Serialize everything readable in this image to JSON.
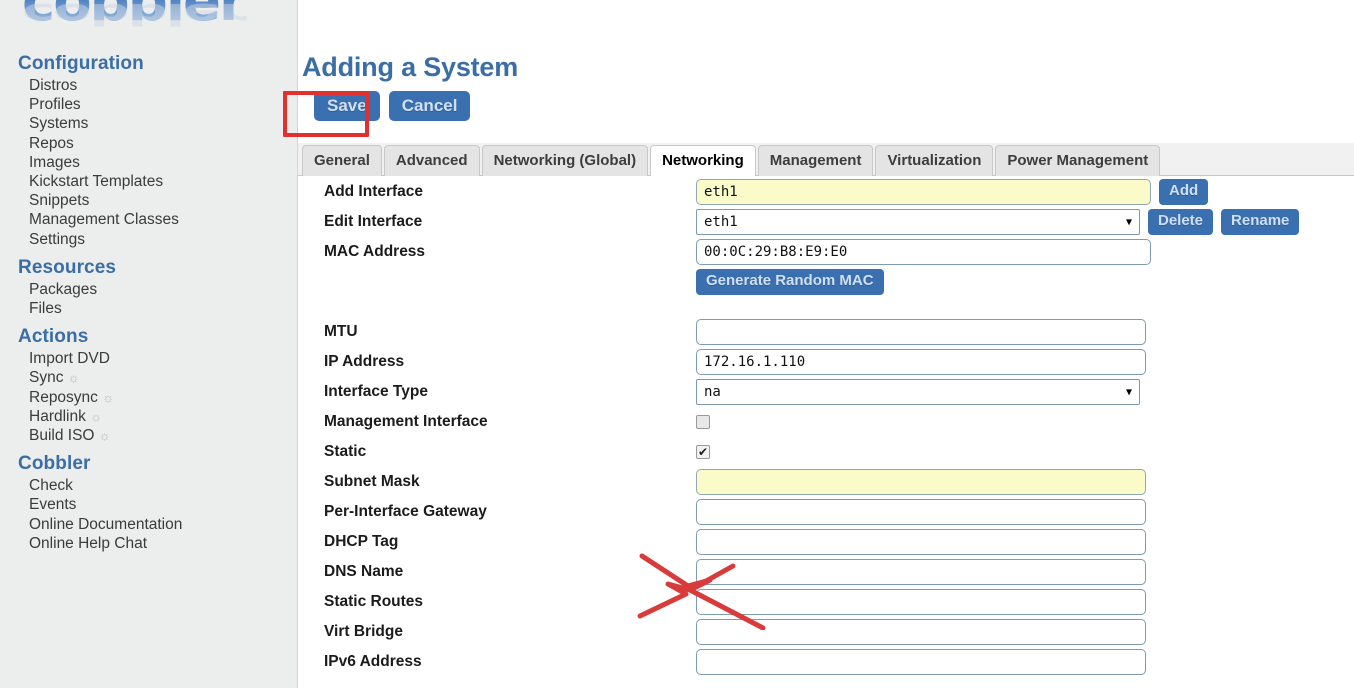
{
  "sidebar": {
    "logo_text": "cobbler",
    "sections": [
      {
        "heading": "Configuration",
        "items": [
          {
            "label": "Distros",
            "gear": false
          },
          {
            "label": "Profiles",
            "gear": false
          },
          {
            "label": "Systems",
            "gear": false
          },
          {
            "label": "Repos",
            "gear": false
          },
          {
            "label": "Images",
            "gear": false
          },
          {
            "label": "Kickstart Templates",
            "gear": false
          },
          {
            "label": "Snippets",
            "gear": false
          },
          {
            "label": "Management Classes",
            "gear": false
          },
          {
            "label": "Settings",
            "gear": false
          }
        ]
      },
      {
        "heading": "Resources",
        "items": [
          {
            "label": "Packages",
            "gear": false
          },
          {
            "label": "Files",
            "gear": false
          }
        ]
      },
      {
        "heading": "Actions",
        "items": [
          {
            "label": "Import DVD",
            "gear": false
          },
          {
            "label": "Sync",
            "gear": true
          },
          {
            "label": "Reposync",
            "gear": true
          },
          {
            "label": "Hardlink",
            "gear": true
          },
          {
            "label": "Build ISO",
            "gear": true
          }
        ]
      },
      {
        "heading": "Cobbler",
        "items": [
          {
            "label": "Check",
            "gear": false
          },
          {
            "label": "Events",
            "gear": false
          },
          {
            "label": "Online Documentation",
            "gear": false
          },
          {
            "label": "Online Help Chat",
            "gear": false
          }
        ]
      }
    ],
    "gear_glyph": "☼"
  },
  "main": {
    "page_title": "Adding a System",
    "save_label": "Save",
    "cancel_label": "Cancel",
    "tabs": [
      {
        "label": "General",
        "active": false
      },
      {
        "label": "Advanced",
        "active": false
      },
      {
        "label": "Networking (Global)",
        "active": false
      },
      {
        "label": "Networking",
        "active": true
      },
      {
        "label": "Management",
        "active": false
      },
      {
        "label": "Virtualization",
        "active": false
      },
      {
        "label": "Power Management",
        "active": false
      }
    ],
    "form": {
      "add_interface": {
        "label": "Add Interface",
        "value": "eth1",
        "button": "Add"
      },
      "edit_interface": {
        "label": "Edit Interface",
        "value": "eth1",
        "delete": "Delete",
        "rename": "Rename"
      },
      "mac_address": {
        "label": "MAC Address",
        "value": "00:0C:29:B8:E9:E0"
      },
      "generate_mac": {
        "label": "Generate Random MAC"
      },
      "mtu": {
        "label": "MTU",
        "value": ""
      },
      "ip_address": {
        "label": "IP Address",
        "value": "172.16.1.110"
      },
      "interface_type": {
        "label": "Interface Type",
        "value": "na"
      },
      "management_interface": {
        "label": "Management Interface",
        "checked": false
      },
      "static": {
        "label": "Static",
        "checked": true
      },
      "subnet_mask": {
        "label": "Subnet Mask",
        "value": ""
      },
      "per_interface_gateway": {
        "label": "Per-Interface Gateway",
        "value": ""
      },
      "dhcp_tag": {
        "label": "DHCP Tag",
        "value": ""
      },
      "dns_name": {
        "label": "DNS Name",
        "value": ""
      },
      "static_routes": {
        "label": "Static Routes",
        "value": ""
      },
      "virt_bridge": {
        "label": "Virt Bridge",
        "value": ""
      },
      "ipv6_address": {
        "label": "IPv6 Address",
        "value": ""
      }
    },
    "checkmark_glyph": "✔"
  },
  "colors": {
    "accent_blue": "#3a6ea5",
    "button_blue": "#3a6fb0",
    "sidebar_bg": "#eceded",
    "highlight_yellow": "#fbfbc9",
    "annotation_red": "#e03030"
  }
}
